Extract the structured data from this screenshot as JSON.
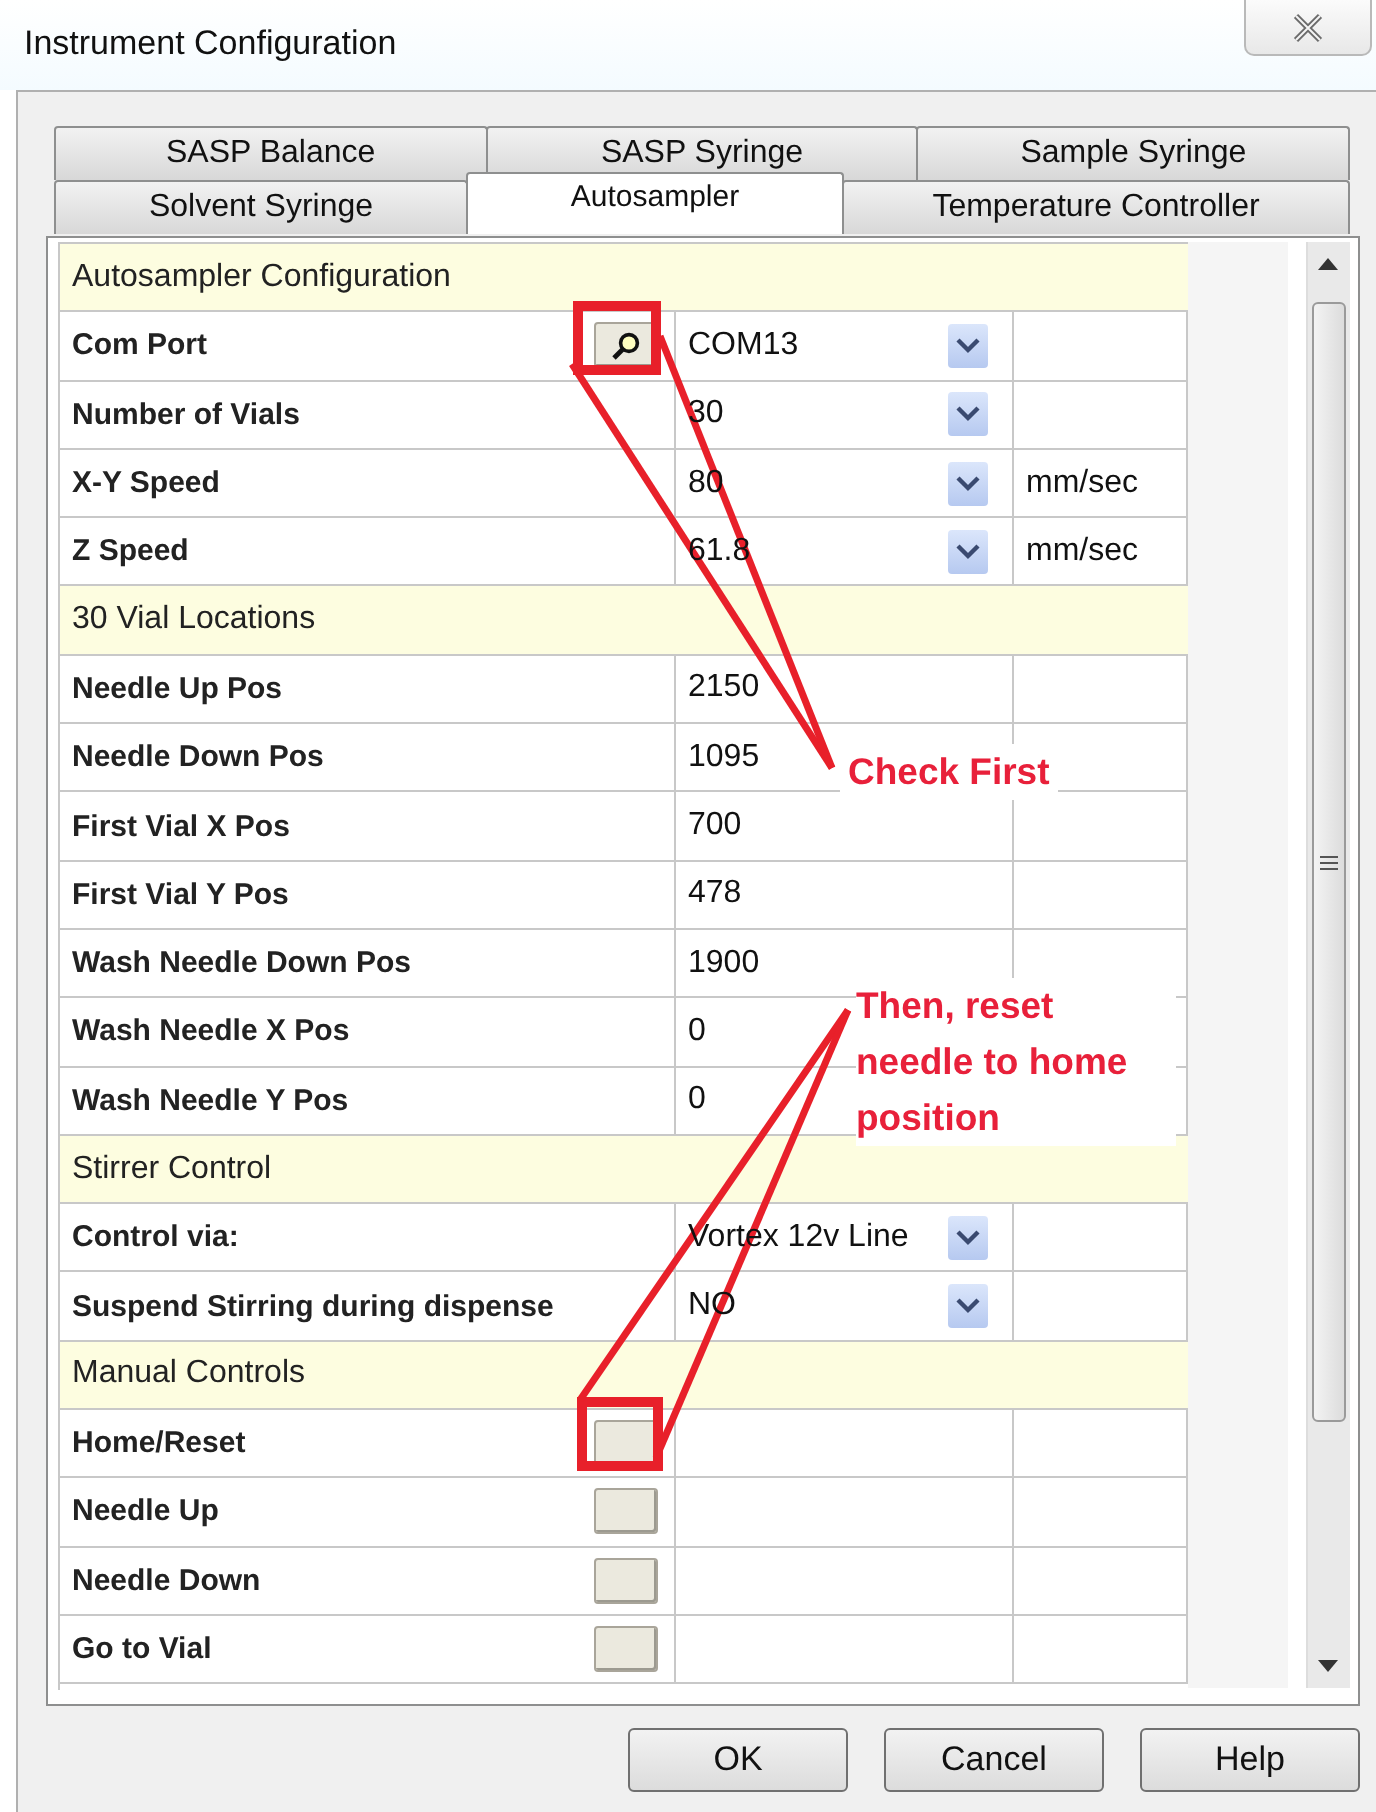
{
  "window": {
    "title": "Instrument Configuration"
  },
  "tab_rows": [
    [
      {
        "label": "SASP Balance",
        "selected": false
      },
      {
        "label": "SASP Syringe",
        "selected": false
      },
      {
        "label": "Sample Syringe",
        "selected": false
      }
    ],
    [
      {
        "label": "Solvent Syringe",
        "selected": false
      },
      {
        "label": "Autosampler",
        "selected": true
      },
      {
        "label": "Temperature Controller",
        "selected": false
      }
    ]
  ],
  "grid": {
    "rows": [
      {
        "kind": "section",
        "label": "Autosampler Configuration"
      },
      {
        "kind": "lookup-combo",
        "label": "Com Port",
        "value": "COM13"
      },
      {
        "kind": "combo",
        "label": "Number of Vials",
        "value": "30"
      },
      {
        "kind": "combo",
        "label": "X-Y Speed",
        "value": "80",
        "unit": "mm/sec"
      },
      {
        "kind": "combo",
        "label": "Z Speed",
        "value": "61.8",
        "unit": "mm/sec"
      },
      {
        "kind": "section",
        "label": "30 Vial Locations"
      },
      {
        "kind": "text",
        "label": "Needle Up Pos",
        "value": "2150"
      },
      {
        "kind": "text",
        "label": "Needle Down Pos",
        "value": "1095"
      },
      {
        "kind": "text",
        "label": "First Vial X Pos",
        "value": "700"
      },
      {
        "kind": "text",
        "label": "First Vial Y Pos",
        "value": "478"
      },
      {
        "kind": "text",
        "label": "Wash Needle Down Pos",
        "value": "1900"
      },
      {
        "kind": "text",
        "label": "Wash Needle X Pos",
        "value": "0"
      },
      {
        "kind": "text",
        "label": "Wash Needle Y Pos",
        "value": "0"
      },
      {
        "kind": "section",
        "label": "Stirrer Control"
      },
      {
        "kind": "combo",
        "label": "Control via:",
        "value": "Vortex 12v Line"
      },
      {
        "kind": "combo",
        "label": "Suspend Stirring during dispense",
        "value": "NO"
      },
      {
        "kind": "section",
        "label": "Manual Controls"
      },
      {
        "kind": "action",
        "label": "Home/Reset"
      },
      {
        "kind": "action",
        "label": "Needle Up"
      },
      {
        "kind": "action",
        "label": "Needle Down"
      },
      {
        "kind": "action",
        "label": "Go to Vial"
      }
    ]
  },
  "annotations": [
    {
      "text": "Check First"
    },
    {
      "text": "Then, reset needle to home position"
    }
  ],
  "buttons": [
    "OK",
    "Cancel",
    "Help"
  ]
}
